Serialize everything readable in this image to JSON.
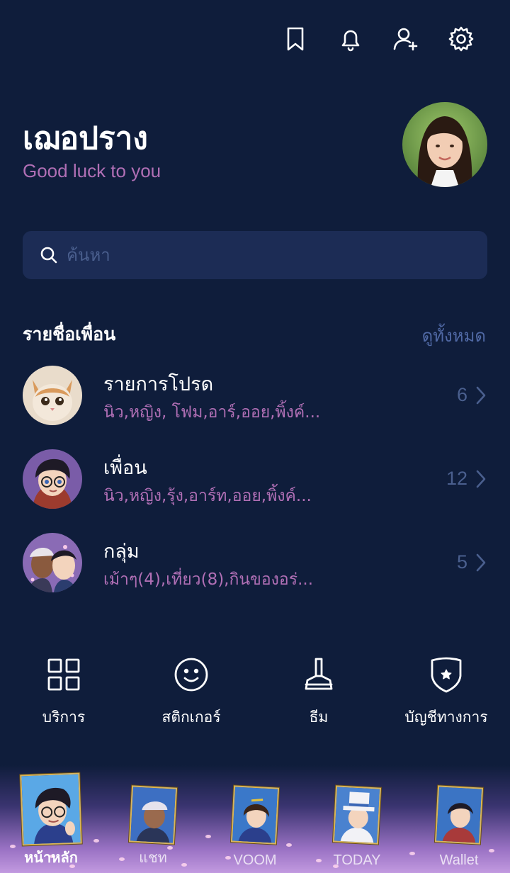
{
  "header": {
    "icons": [
      "bookmark-icon",
      "bell-icon",
      "add-friend-icon",
      "settings-icon"
    ]
  },
  "profile": {
    "name": "เฌอปราง",
    "status": "Good luck to you"
  },
  "search": {
    "placeholder": "ค้นหา"
  },
  "friends_section": {
    "title": "รายชื่อเพื่อน",
    "see_all": "ดูทั้งหมด",
    "rows": [
      {
        "title": "รายการโปรด",
        "subtitle": "นิว,หญิง, โฟม,อาร์,ออย,พิ้งค์...",
        "count": "6"
      },
      {
        "title": "เพื่อน",
        "subtitle": "นิว,หญิง,รุ้ง,อาร์ท,ออย,พิ้งค์...",
        "count": "12"
      },
      {
        "title": "กลุ่ม",
        "subtitle": "เม้าๆ(4),เที่ยว(8),กินของอร่...",
        "count": "5"
      }
    ]
  },
  "shortcuts": [
    {
      "label": "บริการ",
      "icon": "grid-icon"
    },
    {
      "label": "สติกเกอร์",
      "icon": "smiley-icon"
    },
    {
      "label": "ธีม",
      "icon": "brush-icon"
    },
    {
      "label": "บัญชีทางการ",
      "icon": "shield-star-icon"
    }
  ],
  "bottom_nav": [
    {
      "label": "หน้าหลัก",
      "active": true
    },
    {
      "label": "แชท",
      "active": false
    },
    {
      "label": "VOOM",
      "active": false
    },
    {
      "label": "TODAY",
      "active": false
    },
    {
      "label": "Wallet",
      "active": false
    }
  ],
  "colors": {
    "background": "#0f1d3b",
    "search_bg": "#1c2c55",
    "accent_pink": "#b06fb5",
    "muted_blue": "#4a5f8e"
  }
}
